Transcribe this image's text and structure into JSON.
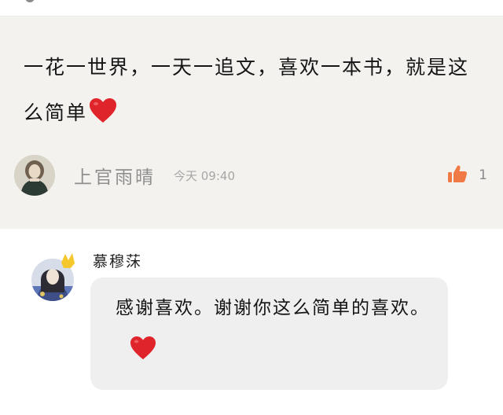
{
  "comment": {
    "text": "一花一世界，一天一追文，喜欢一本书，就是这么简单",
    "emoji": "heart-emoji",
    "author": "上官雨晴",
    "time": "今天 09:40",
    "like_count": "1",
    "like_icon_color": "#f07a45"
  },
  "reply": {
    "author": "慕穆莯",
    "text": "感谢喜欢。谢谢你这么简单的喜欢。",
    "emoji": "heart-emoji"
  },
  "colors": {
    "card_bg": "#f3f2ee",
    "bubble_bg": "#efefef",
    "heart": "#e0242b",
    "crown": "#f4c82c"
  }
}
